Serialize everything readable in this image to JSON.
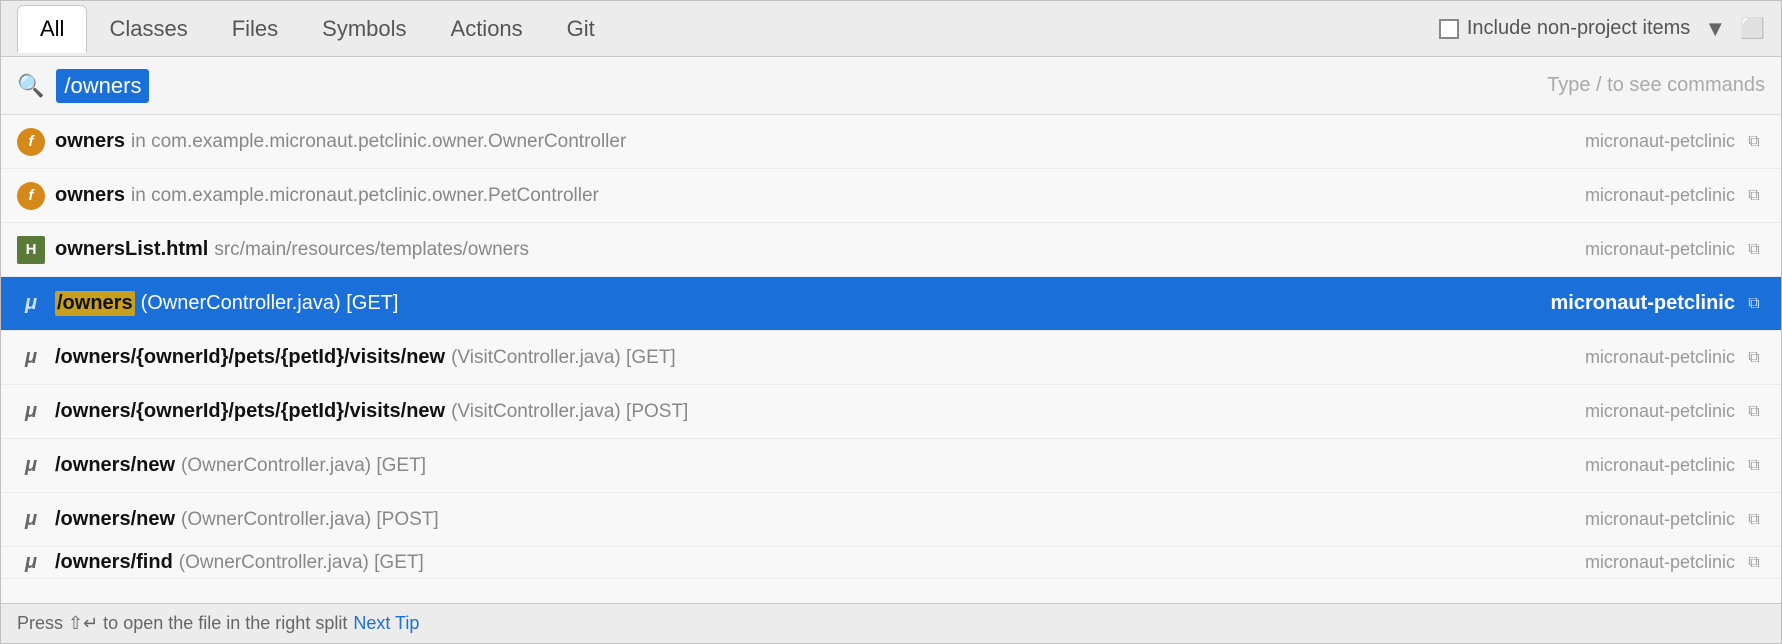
{
  "tabs": [
    {
      "label": "All",
      "active": true
    },
    {
      "label": "Classes",
      "active": false
    },
    {
      "label": "Files",
      "active": false
    },
    {
      "label": "Symbols",
      "active": false
    },
    {
      "label": "Actions",
      "active": false
    },
    {
      "label": "Git",
      "active": false
    }
  ],
  "header": {
    "include_label": "Include non-project items",
    "filter_icon": "▼",
    "window_icon": "⬜"
  },
  "search": {
    "placeholder": "Search",
    "value": "/owners",
    "hint": "Type / to see commands"
  },
  "results": [
    {
      "icon_type": "f-orange",
      "icon_label": "f",
      "name": "owners",
      "detail": "in com.example.micronaut.petclinic.owner.OwnerController",
      "module": "micronaut-petclinic",
      "selected": false
    },
    {
      "icon_type": "f-orange",
      "icon_label": "f",
      "name": "owners",
      "detail": "in com.example.micronaut.petclinic.owner.PetController",
      "module": "micronaut-petclinic",
      "selected": false
    },
    {
      "icon_type": "h-green",
      "icon_label": "H",
      "name": "ownersList.html",
      "detail": "src/main/resources/templates/owners",
      "module": "micronaut-petclinic",
      "selected": false
    },
    {
      "icon_type": "mu",
      "icon_label": "μ",
      "name_highlight": "/owners",
      "name_suffix": "",
      "detail": "(OwnerController.java) [GET]",
      "module": "micronaut-petclinic",
      "selected": true
    },
    {
      "icon_type": "mu",
      "icon_label": "μ",
      "name": "/owners/{ownerId}/pets/{petId}/visits/new",
      "detail": "(VisitController.java) [GET]",
      "module": "micronaut-petclinic",
      "selected": false
    },
    {
      "icon_type": "mu",
      "icon_label": "μ",
      "name": "/owners/{ownerId}/pets/{petId}/visits/new",
      "detail": "(VisitController.java) [POST]",
      "module": "micronaut-petclinic",
      "selected": false
    },
    {
      "icon_type": "mu",
      "icon_label": "μ",
      "name": "/owners/new",
      "detail": "(OwnerController.java) [GET]",
      "module": "micronaut-petclinic",
      "selected": false
    },
    {
      "icon_type": "mu",
      "icon_label": "μ",
      "name": "/owners/new",
      "detail": "(OwnerController.java) [POST]",
      "module": "micronaut-petclinic",
      "selected": false
    },
    {
      "icon_type": "mu",
      "icon_label": "μ",
      "name": "/owners/find",
      "detail": "(OwnerController.java) [GET]",
      "module": "micronaut-petclinic",
      "selected": false,
      "partial": true
    }
  ],
  "status_bar": {
    "text": "Press ⇧↵ to open the file in the right split",
    "next_tip_label": "Next Tip"
  }
}
